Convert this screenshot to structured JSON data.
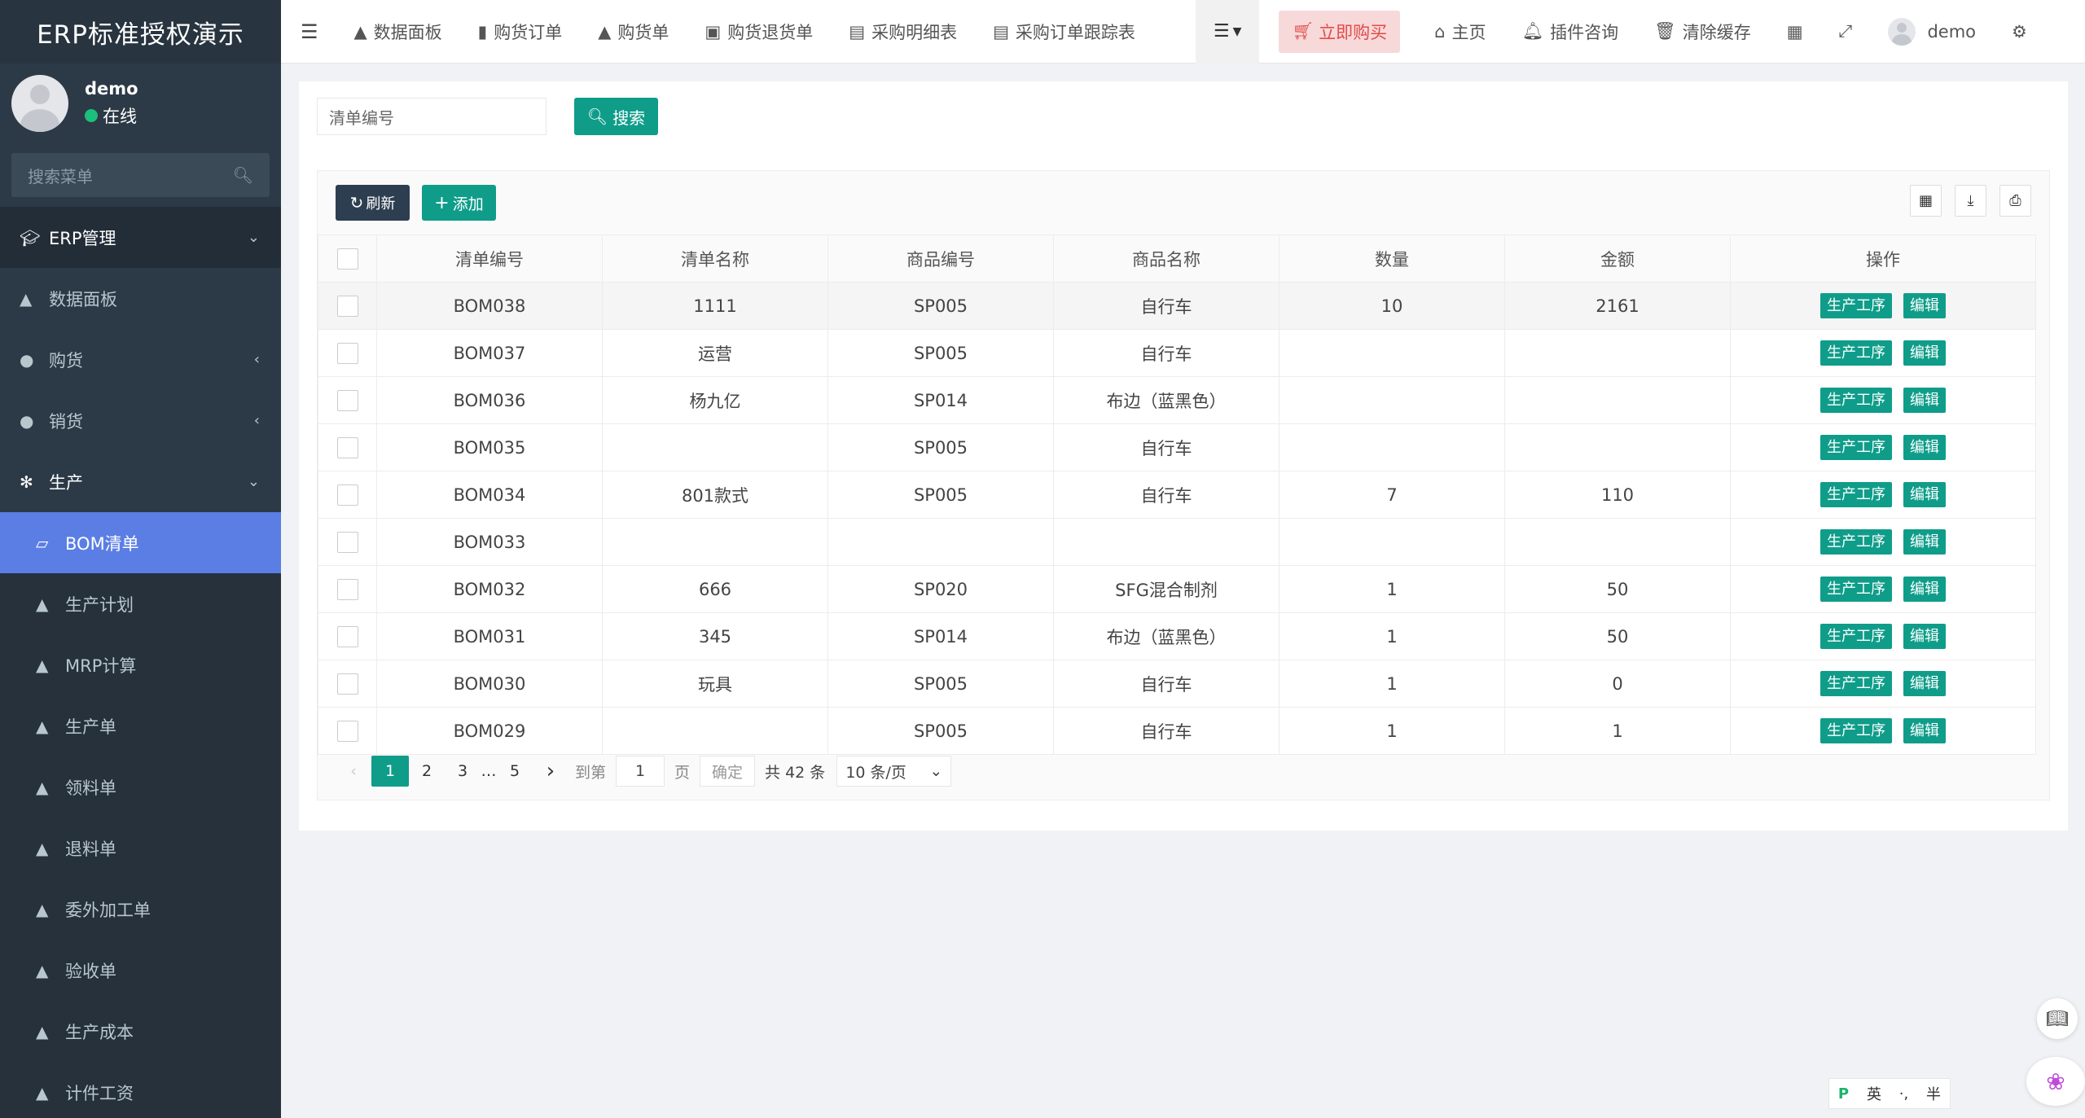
{
  "brand": "ERP标准授权演示",
  "user": {
    "name": "demo",
    "status": "在线"
  },
  "sidebar": {
    "search_placeholder": "搜索菜单",
    "items": [
      {
        "label": "ERP管理",
        "icon": "graduation-cap-icon",
        "type": "header"
      },
      {
        "label": "数据面板",
        "icon": "area-chart-icon"
      },
      {
        "label": "购货",
        "icon": "github-icon"
      },
      {
        "label": "销货",
        "icon": "apple-icon"
      },
      {
        "label": "生产",
        "icon": "yelp-icon"
      },
      {
        "label": "BOM清单",
        "icon": "eraser-icon",
        "active": true
      },
      {
        "label": "生产计划",
        "icon": "area-chart-icon"
      },
      {
        "label": "MRP计算",
        "icon": "area-chart-icon"
      },
      {
        "label": "生产单",
        "icon": "area-chart-icon"
      },
      {
        "label": "领料单",
        "icon": "area-chart-icon"
      },
      {
        "label": "退料单",
        "icon": "area-chart-icon"
      },
      {
        "label": "委外加工单",
        "icon": "area-chart-icon"
      },
      {
        "label": "验收单",
        "icon": "area-chart-icon"
      },
      {
        "label": "生产成本",
        "icon": "area-chart-icon"
      },
      {
        "label": "计件工资",
        "icon": "area-chart-icon"
      }
    ]
  },
  "topnav": {
    "tabs": [
      "数据面板",
      "购货订单",
      "购货单",
      "购货退货单",
      "采购明细表",
      "采购订单跟踪表"
    ],
    "buy_now": "立即购买",
    "home": "主页",
    "plugin": "插件咨询",
    "clear_cache": "清除缓存",
    "username": "demo"
  },
  "search": {
    "placeholder": "清单编号",
    "button": "搜索"
  },
  "toolbar": {
    "refresh": "刷新",
    "add": "添加"
  },
  "table": {
    "headers": [
      "清单编号",
      "清单名称",
      "商品编号",
      "商品名称",
      "数量",
      "金额",
      "操作"
    ],
    "action_labels": [
      "生产工序",
      "编辑"
    ],
    "rows": [
      [
        "BOM038",
        "1111",
        "SP005",
        "自行车",
        "10",
        "2161"
      ],
      [
        "BOM037",
        "运营",
        "SP005",
        "自行车",
        "",
        ""
      ],
      [
        "BOM036",
        "杨九亿",
        "SP014",
        "布边（蓝黑色）",
        "",
        ""
      ],
      [
        "BOM035",
        "",
        "SP005",
        "自行车",
        "",
        ""
      ],
      [
        "BOM034",
        "801款式",
        "SP005",
        "自行车",
        "7",
        "110"
      ],
      [
        "BOM033",
        "",
        "",
        "",
        "",
        ""
      ],
      [
        "BOM032",
        "666",
        "SP020",
        "SFG混合制剂",
        "1",
        "50"
      ],
      [
        "BOM031",
        "345",
        "SP014",
        "布边（蓝黑色）",
        "1",
        "50"
      ],
      [
        "BOM030",
        "玩具",
        "SP005",
        "自行车",
        "1",
        "0"
      ],
      [
        "BOM029",
        "",
        "SP005",
        "自行车",
        "1",
        "1"
      ]
    ]
  },
  "pagination": {
    "pages": [
      "1",
      "2",
      "3",
      "…",
      "5"
    ],
    "goto_label": "到第",
    "goto_value": "1",
    "page_label": "页",
    "confirm": "确定",
    "total": "共 42 条",
    "page_size": "10 条/页"
  },
  "ime": {
    "lang": "英",
    "punct": "·,",
    "width": "半"
  }
}
